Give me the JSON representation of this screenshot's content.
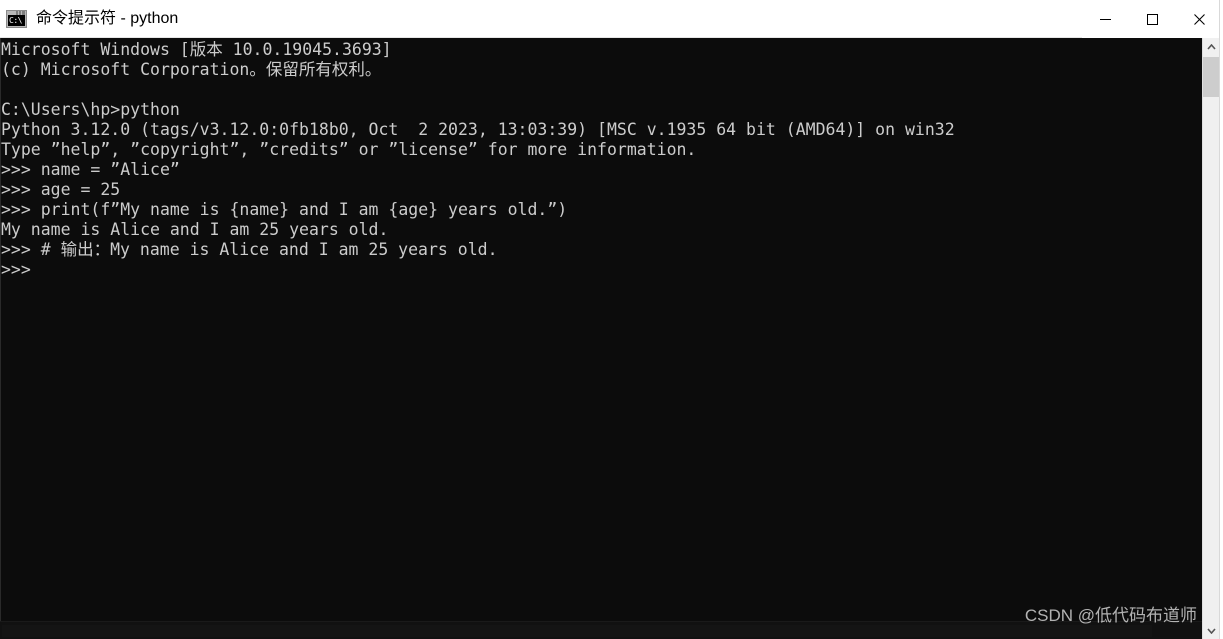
{
  "window": {
    "title": "命令提示符 - python",
    "icon": "cmd-icon",
    "icon_text": "C:\\",
    "controls": {
      "minimize": "minimize-button",
      "maximize": "maximize-button",
      "close": "close-button"
    },
    "colors": {
      "titlebar_bg": "#ffffff",
      "titlebar_fg": "#000000",
      "terminal_bg": "#0c0c0c",
      "terminal_fg": "#cccccc",
      "scrollbar_track": "#f0f0f0",
      "scrollbar_thumb": "#cdcdcd"
    }
  },
  "terminal": {
    "lines": [
      "Microsoft Windows [版本 10.0.19045.3693]",
      "(c) Microsoft Corporation。保留所有权利。",
      "",
      "C:\\Users\\hp>python",
      "Python 3.12.0 (tags/v3.12.0:0fb18b0, Oct  2 2023, 13:03:39) [MSC v.1935 64 bit (AMD64)] on win32",
      "Type ”help”, ”copyright”, ”credits” or ”license” for more information.",
      ">>> name = ”Alice”",
      ">>> age = 25",
      ">>> print(f”My name is {name} and I am {age} years old.”)",
      "My name is Alice and I am 25 years old.",
      ">>> # 输出：My name is Alice and I am 25 years old.",
      ">>>"
    ]
  },
  "scrollbars": {
    "vertical": {
      "up_arrow": "chevron-up-icon",
      "down_arrow": "chevron-down-icon",
      "thumb": "scroll-thumb"
    },
    "horizontal": {
      "thumb": "scroll-thumb-horizontal"
    }
  },
  "watermark": {
    "text": "CSDN @低代码布道师"
  }
}
